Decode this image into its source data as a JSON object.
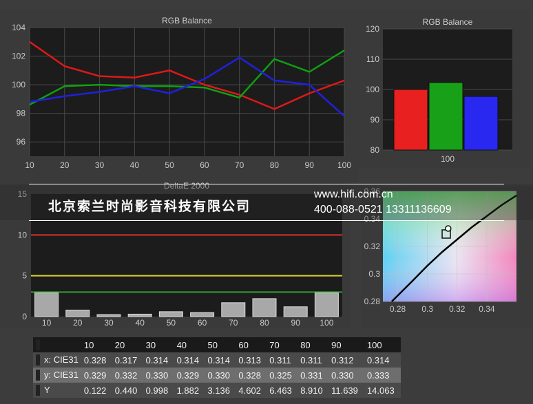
{
  "chart_data": [
    {
      "type": "line",
      "title": "RGB Balance",
      "x": [
        10,
        20,
        30,
        40,
        50,
        60,
        70,
        80,
        90,
        100
      ],
      "ylim": [
        95,
        104
      ],
      "yticks": [
        96,
        98,
        100,
        102,
        104
      ],
      "series": [
        {
          "color": "#e01818",
          "values": [
            103.0,
            101.3,
            100.6,
            100.5,
            101.0,
            100.0,
            99.3,
            98.3,
            99.4,
            100.3
          ]
        },
        {
          "color": "#10a010",
          "values": [
            98.6,
            99.9,
            100.0,
            99.9,
            99.9,
            99.8,
            99.1,
            101.8,
            100.9,
            102.4
          ]
        },
        {
          "color": "#2020e0",
          "values": [
            98.8,
            99.2,
            99.5,
            99.9,
            99.4,
            100.4,
            101.9,
            100.3,
            100.0,
            97.8
          ]
        }
      ]
    },
    {
      "type": "bar",
      "title": "RGB Balance",
      "categories": [
        "100"
      ],
      "ylim": [
        80,
        120
      ],
      "yticks": [
        80,
        90,
        100,
        110,
        120
      ],
      "series": [
        {
          "color": "#e82020",
          "values": [
            100.0
          ]
        },
        {
          "color": "#18a018",
          "values": [
            102.3
          ]
        },
        {
          "color": "#2828f0",
          "values": [
            97.7
          ]
        }
      ]
    },
    {
      "type": "bar",
      "title": "DeltaE 2000",
      "categories": [
        "10",
        "20",
        "30",
        "40",
        "50",
        "60",
        "70",
        "80",
        "90",
        "100"
      ],
      "values": [
        2.9,
        0.8,
        0.25,
        0.3,
        0.6,
        0.5,
        1.7,
        2.2,
        1.2,
        2.9
      ],
      "ylim": [
        0,
        15
      ],
      "yticks": [
        0,
        5,
        10,
        15
      ],
      "reference_lines": [
        {
          "value": 10,
          "color": "#e03030"
        },
        {
          "value": 5,
          "color": "#d8d030"
        },
        {
          "value": 3,
          "color": "#30a030"
        }
      ]
    },
    {
      "type": "scatter",
      "title": "",
      "xlim": [
        0.27,
        0.36
      ],
      "ylim": [
        0.28,
        0.36
      ],
      "xticks": [
        0.28,
        0.3,
        0.32,
        0.34
      ],
      "yticks": [
        0.28,
        0.3,
        0.32,
        0.34,
        0.36
      ],
      "yticklabels": [
        "0.28",
        "0.3",
        "0.32",
        "0.34",
        "0.36"
      ],
      "points": [
        {
          "x": 0.3127,
          "y": 0.329,
          "marker": "square"
        },
        {
          "x": 0.314,
          "y": 0.333,
          "marker": "circle"
        }
      ],
      "curve": [
        [
          0.276,
          0.28
        ],
        [
          0.29,
          0.295
        ],
        [
          0.3,
          0.306
        ],
        [
          0.31,
          0.316
        ],
        [
          0.32,
          0.325
        ],
        [
          0.33,
          0.334
        ],
        [
          0.34,
          0.342
        ],
        [
          0.35,
          0.35
        ],
        [
          0.36,
          0.357
        ]
      ]
    },
    {
      "type": "table",
      "columns": [
        "",
        "10",
        "20",
        "30",
        "40",
        "50",
        "60",
        "70",
        "80",
        "90",
        "100"
      ],
      "rows": [
        [
          "x: CIE31",
          "0.328",
          "0.317",
          "0.314",
          "0.314",
          "0.314",
          "0.313",
          "0.311",
          "0.311",
          "0.312",
          "0.314"
        ],
        [
          "y: CIE31",
          "0.329",
          "0.332",
          "0.330",
          "0.329",
          "0.330",
          "0.328",
          "0.325",
          "0.331",
          "0.330",
          "0.333"
        ],
        [
          "Y",
          "0.122",
          "0.440",
          "0.998",
          "1.882",
          "3.136",
          "4.602",
          "6.463",
          "8.910",
          "11.639",
          "14.063"
        ]
      ]
    }
  ],
  "watermark": {
    "company": "北京索兰时尚影音科技有限公司",
    "url": "www.hifi.com.cn",
    "phone": "400-088-0521  13311136609"
  }
}
